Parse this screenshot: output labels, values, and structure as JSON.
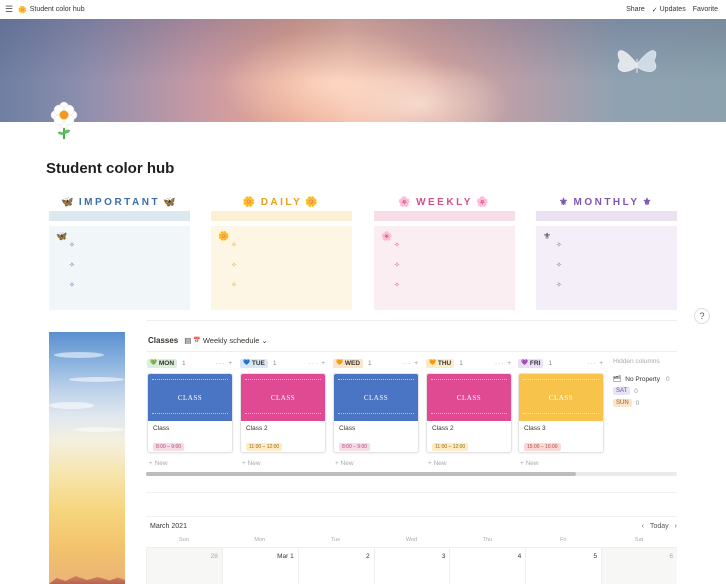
{
  "topbar": {
    "menu_icon": "hamburger-icon",
    "page_title": "Student color hub",
    "share": "Share",
    "updates": "Updates",
    "favorite": "Favorite"
  },
  "page": {
    "title": "Student color hub",
    "icon": "daisy-flower-icon"
  },
  "sections": [
    {
      "label": "IMPORTANT",
      "emoji": "🦋",
      "bar_color": "#dce8ef",
      "body_color": "#f1f6f9",
      "accent": "#3b6fa8"
    },
    {
      "label": "DAILY",
      "emoji": "🌼",
      "bar_color": "#fbefd4",
      "body_color": "#fdf6e4",
      "accent": "#e5a21a"
    },
    {
      "label": "WEEKLY",
      "emoji": "🌸",
      "bar_color": "#f8dde9",
      "body_color": "#fbeef3",
      "accent": "#d4508a"
    },
    {
      "label": "MONTHLY",
      "emoji": "⚜",
      "bar_color": "#ebe2f1",
      "body_color": "#f3eef7",
      "accent": "#7d57b3"
    }
  ],
  "bullet_glyph": "✧",
  "help": "?",
  "classes": {
    "title": "Classes",
    "view_label": "Weekly schedule",
    "columns": [
      {
        "day": "MON",
        "emoji": "💚",
        "count": "1",
        "tag_bg": "#dbeddb",
        "card_color": "#4a74c4",
        "cover_text": "CLASS",
        "name": "Class",
        "time": "8:00 – 9:00",
        "time_bg": "#f5dbe6",
        "time_color": "#b04a7b",
        "new": "+ New"
      },
      {
        "day": "TUE",
        "emoji": "💙",
        "count": "1",
        "tag_bg": "#dbe7f5",
        "card_color": "#e04a93",
        "cover_text": "CLASS",
        "name": "Class 2",
        "time": "11:00 – 12:00",
        "time_bg": "#fbecc9",
        "time_color": "#9a6a00",
        "new": "+ New"
      },
      {
        "day": "WED",
        "emoji": "🧡",
        "count": "1",
        "tag_bg": "#fbe4c9",
        "card_color": "#4a74c4",
        "cover_text": "CLASS",
        "name": "Class",
        "time": "8:00 – 9:00",
        "time_bg": "#f5dbe6",
        "time_color": "#b04a7b",
        "new": "+ New"
      },
      {
        "day": "THU",
        "emoji": "🧡",
        "count": "1",
        "tag_bg": "#fbecc9",
        "card_color": "#e04a93",
        "cover_text": "CLASS",
        "name": "Class 2",
        "time": "11:00 – 12:00",
        "time_bg": "#fbecc9",
        "time_color": "#9a6a00",
        "new": "+ New"
      },
      {
        "day": "FRI",
        "emoji": "💜",
        "count": "1",
        "tag_bg": "#e9dff6",
        "card_color": "#f8c34a",
        "cover_text": "CLASS",
        "name": "Class 3",
        "time": "15:00 – 16:00",
        "time_bg": "#f9d9d6",
        "time_color": "#b24c40",
        "new": "+ New"
      }
    ],
    "hidden": {
      "label": "Hidden columns",
      "no_property": "No Property",
      "no_property_count": "0",
      "sat": "SAT",
      "sat_count": "0",
      "sun": "SUN",
      "sun_count": "0"
    }
  },
  "calendar": {
    "month": "March 2021",
    "today": "Today",
    "weekdays": [
      "Sun",
      "Mon",
      "Tue",
      "Wed",
      "Thu",
      "Fri",
      "Sat"
    ],
    "first_row": [
      "28",
      "Mar 1",
      "2",
      "3",
      "4",
      "5",
      "6"
    ]
  }
}
